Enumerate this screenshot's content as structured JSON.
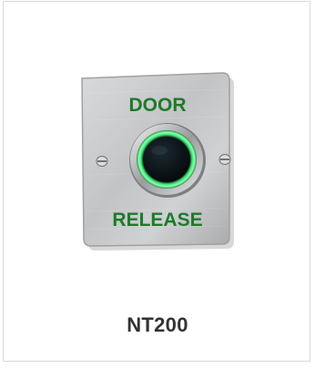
{
  "product": {
    "name": "NT200",
    "plate_text_top": "DOOR",
    "plate_text_bottom": "RELEASE",
    "image_subject": "stainless-steel-door-release-button",
    "colors": {
      "legend_green": "#1e7a2a",
      "led_ring": "#3ff07a",
      "plate_steel": "#c4c6c8",
      "title_text": "#333333"
    }
  }
}
